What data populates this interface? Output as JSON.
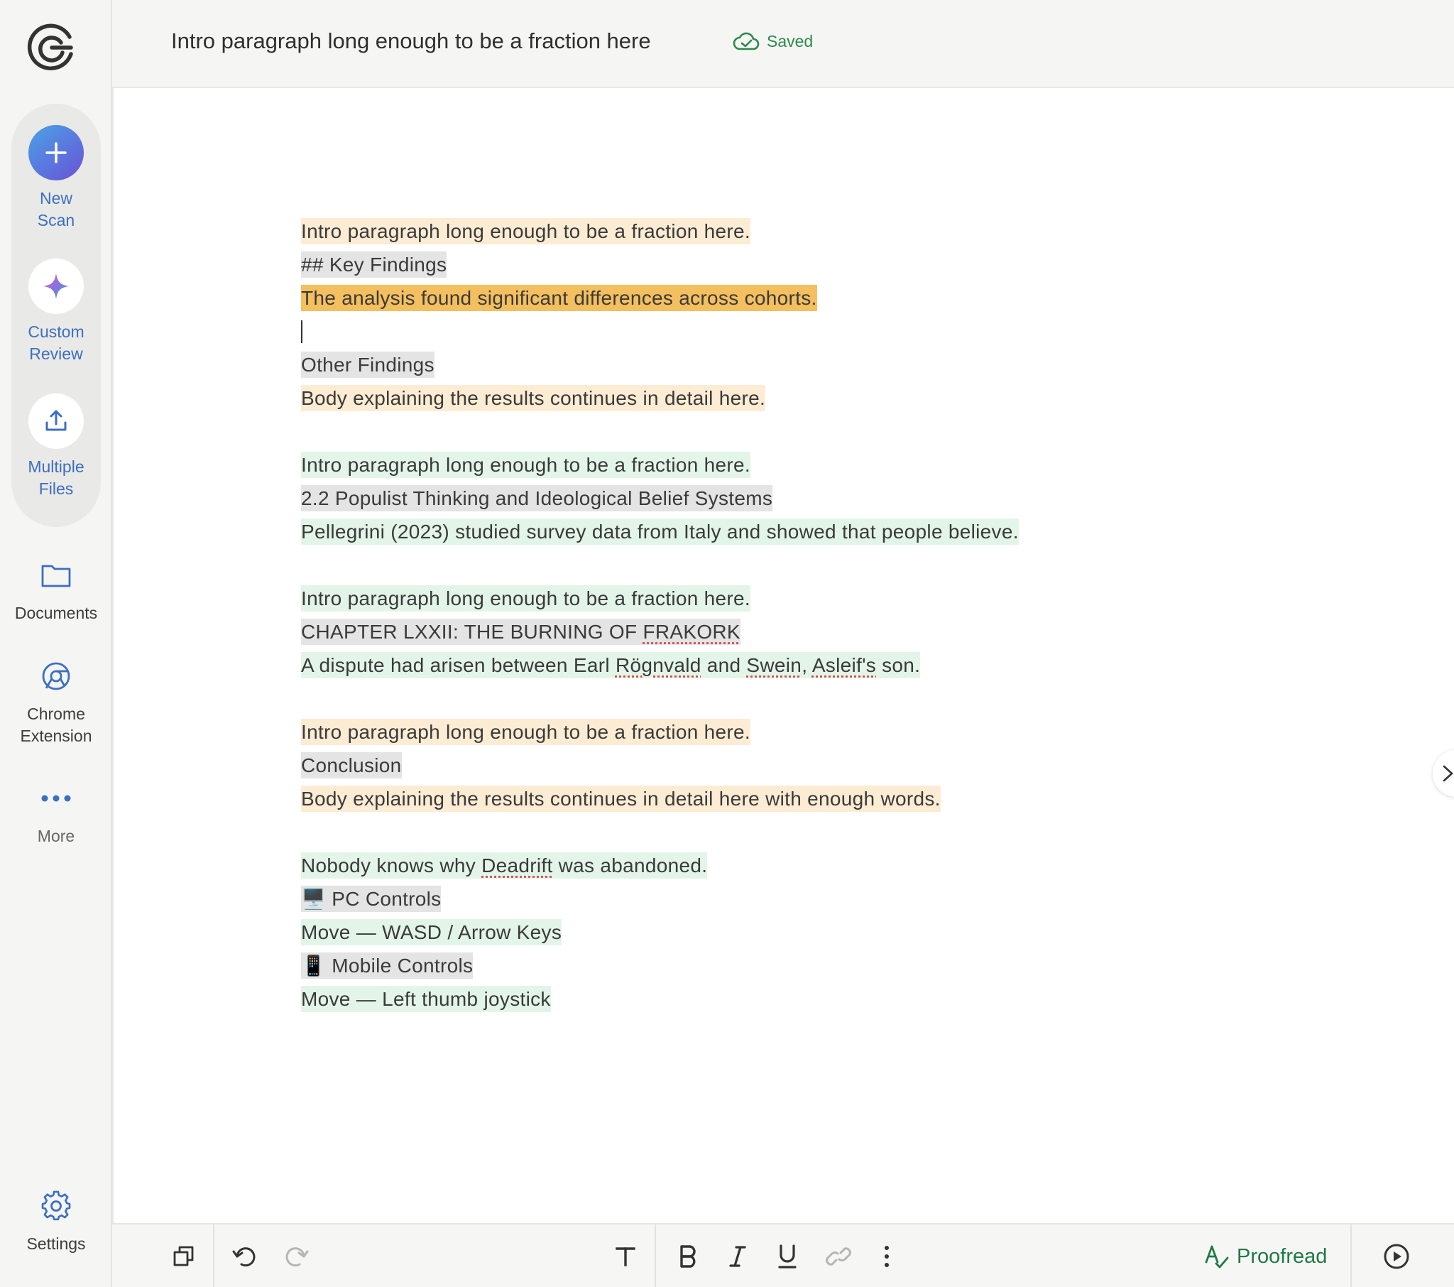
{
  "sidebar": {
    "items": [
      {
        "label_1": "New",
        "label_2": "Scan"
      },
      {
        "label_1": "Custom",
        "label_2": "Review"
      },
      {
        "label_1": "Multiple",
        "label_2": "Files"
      },
      {
        "label_1": "Documents"
      },
      {
        "label_1": "Chrome",
        "label_2": "Extension"
      },
      {
        "label_1": "More"
      }
    ],
    "settings_label": "Settings"
  },
  "header": {
    "title": "Intro paragraph long enough to be a fraction here",
    "saved_label": "Saved"
  },
  "document": {
    "lines": [
      "Intro paragraph long enough to be a fraction here.",
      "## Key Findings",
      "The analysis found significant differences across cohorts.",
      "",
      "Other Findings",
      "Body explaining the results continues in detail here.",
      "",
      "Intro paragraph long enough to be a fraction here.",
      "2.2 Populist Thinking and Ideological Belief Systems",
      "Pellegrini (2023) studied survey data from Italy and showed that people believe.",
      "",
      "Intro paragraph long enough to be a fraction here.",
      "CHAPTER LXXII: THE BURNING OF FRAKORK",
      "A dispute had arisen between Earl Rögnvald and Swein, Asleif's son.",
      "",
      "Intro paragraph long enough to be a fraction here.",
      "Conclusion",
      "Body explaining the results continues in detail here with enough words.",
      "",
      "Nobody knows why Deadrift was abandoned.",
      "🖥️ PC Controls",
      "Move — WASD / Arrow Keys",
      "📱 Mobile Controls",
      "Move — Left thumb joystick"
    ],
    "chapter_parts": {
      "a": "CHAPTER LXXII: THE BURNING OF ",
      "b": "FRAKORK"
    },
    "dispute_parts": {
      "a": "A dispute had arisen between Earl ",
      "b": "Rögnvald",
      "c": " and ",
      "d": "Swein",
      "e": ", ",
      "f": "Asleif's",
      "g": " son."
    },
    "deadrift_parts": {
      "a": "Nobody knows why ",
      "b": "Deadrift",
      "c": " was abandoned."
    }
  },
  "toolbar": {
    "proofread_label": "Proofread"
  },
  "colors": {
    "accent_blue": "#3c6fc0",
    "saved_green": "#2c8a4a",
    "proofread_green": "#1f7a45",
    "highlight_peach": "#fdecd4",
    "highlight_orange": "#f4bf5e",
    "highlight_gray": "#e4e4e4",
    "highlight_green": "#e3f5e8"
  },
  "icons": [
    "app-logo-icon",
    "plus-icon",
    "sparkle-icon",
    "upload-icon",
    "folder-icon",
    "chrome-icon",
    "more-dots-icon",
    "gear-icon",
    "cloud-check-icon",
    "chevron-right-icon",
    "copy-icon",
    "undo-icon",
    "redo-icon",
    "text-format-icon",
    "bold-icon",
    "italic-icon",
    "underline-icon",
    "link-icon",
    "vertical-dots-icon",
    "proofread-icon",
    "play-icon"
  ]
}
